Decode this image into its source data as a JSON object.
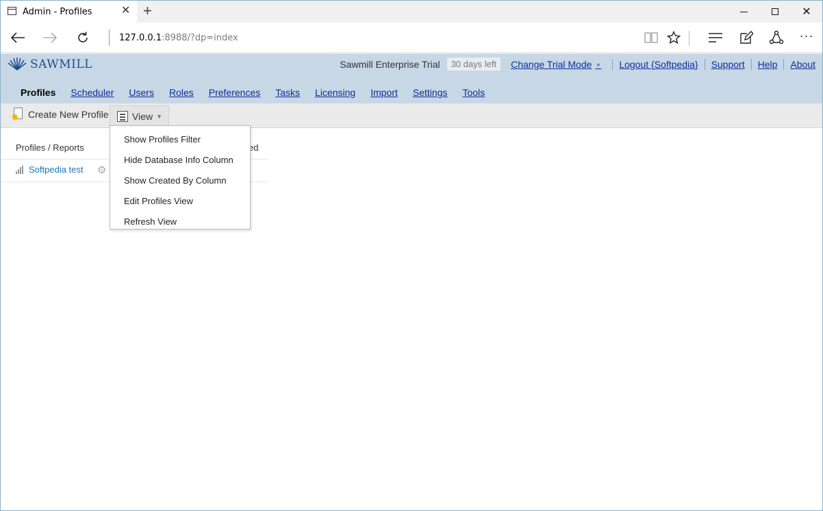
{
  "browser": {
    "tab_title": "Admin - Profiles",
    "address_host": "127.0.0.1",
    "address_rest": ":8988/?dp=index"
  },
  "app": {
    "logo": {
      "text": "SAWMILL"
    },
    "trial_label": "Sawmill Enterprise Trial",
    "days_left": "30 days left",
    "links": {
      "change_trial_mode": "Change Trial Mode",
      "logout": "Logout {Softpedia}",
      "support": "Support",
      "help": "Help",
      "about": "About"
    },
    "nav": {
      "profiles": "Profiles",
      "scheduler": "Scheduler",
      "users": "Users",
      "roles": "Roles",
      "preferences": "Preferences",
      "tasks": "Tasks",
      "licensing": "Licensing",
      "import": "Import",
      "settings": "Settings",
      "tools": "Tools"
    }
  },
  "toolbar": {
    "create_label": "Create New Profile",
    "view_label": "View"
  },
  "table": {
    "col_profiles": "Profiles / Reports",
    "col_partial": "ed",
    "rows": [
      {
        "name": "Softpedia test"
      }
    ]
  },
  "view_menu": {
    "items": [
      "Show Profiles Filter",
      "Hide Database Info Column",
      "Show Created By Column",
      "Edit Profiles View",
      "Refresh View"
    ]
  },
  "colors": {
    "header_bg": "#c7d7e6",
    "link": "#0b2e9a",
    "profile_link": "#1a73c4"
  }
}
